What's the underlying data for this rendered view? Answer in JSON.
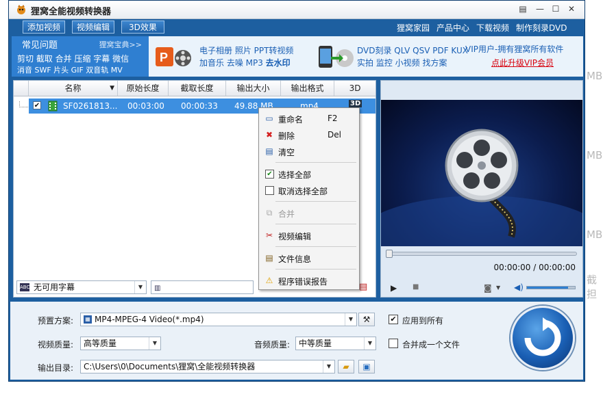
{
  "window": {
    "title": "狸窝全能视频转换器",
    "controls": [
      "▤",
      "—",
      "☐",
      "✕"
    ]
  },
  "toolbar": {
    "add_video": "添加视频",
    "video_edit": "视频编辑",
    "effect_3d": "3D效果",
    "links": [
      "狸窝家园",
      "产品中心",
      "下载视频",
      "制作刻录DVD"
    ]
  },
  "banner": {
    "faq_title": "常见问题",
    "faq_more": "狸窝宝典>>",
    "faq_line1": "剪切 截取 合并 压缩 字幕 微信",
    "faq_line2": "消音 SWF 片头 GIF 双音轨 MV",
    "promo1_line1": "电子相册 照片 PPT转视频",
    "promo1_line2a": "加音乐 去噪 MP3 ",
    "promo1_line2b": "去水印",
    "promo2_line1": "DVD刻录 QLV QSV PDF KUX",
    "promo2_line2": "实拍 监控 小视频 找方案",
    "vip_line1": "VIP用户-拥有狸窝所有软件",
    "vip_line2": "点此升级VIP会员"
  },
  "filelist": {
    "columns": [
      "名称",
      "原始长度",
      "截取长度",
      "输出大小",
      "输出格式",
      "3D"
    ],
    "rows": [
      {
        "name": "SF0261813...",
        "original": "00:03:00",
        "clip": "00:00:33",
        "size": "49.88 MB",
        "format": "mp4",
        "d3": "3D"
      }
    ],
    "subtitle_select": "无可用字幕"
  },
  "context_menu": {
    "items": [
      {
        "label": "重命名",
        "shortcut": "F2",
        "icon": "rename-icon"
      },
      {
        "label": "删除",
        "shortcut": "Del",
        "icon": "delete-x-icon"
      },
      {
        "label": "清空",
        "icon": "clear-icon"
      },
      {
        "label": "选择全部",
        "icon": "checkbox-checked-icon"
      },
      {
        "label": "取消选择全部",
        "icon": "checkbox-empty-icon"
      },
      {
        "label": "合并",
        "icon": "merge-icon",
        "disabled": true
      },
      {
        "label": "视频编辑",
        "icon": "scissors-icon"
      },
      {
        "label": "文件信息",
        "icon": "notepad-icon"
      },
      {
        "label": "程序错误报告",
        "icon": "warning-icon"
      }
    ]
  },
  "preview": {
    "time": "00:00:00 / 00:00:00",
    "volume_level": 0.85
  },
  "settings": {
    "preset_label": "预置方案:",
    "preset_value": "MP4-MPEG-4 Video(*.mp4)",
    "apply_all": "应用到所有",
    "video_quality_label": "视频质量:",
    "video_quality_value": "高等质量",
    "audio_quality_label": "音频质量:",
    "audio_quality_value": "中等质量",
    "merge_one": "合并成一个文件",
    "output_label": "输出目录:",
    "output_value": "C:\\Users\\0\\Documents\\狸窝\\全能视频转换器"
  },
  "background_fragments": [
    "MB",
    "MB",
    "MB",
    "截担"
  ],
  "colors": {
    "accent": "#1d5fa0",
    "selection": "#3d8fe0",
    "link_red": "#d8000c"
  }
}
